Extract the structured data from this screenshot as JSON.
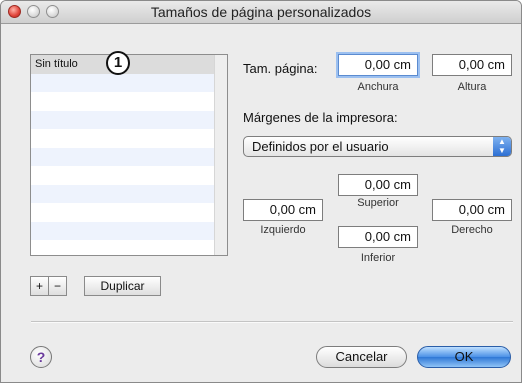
{
  "window": {
    "title": "Tamaños de página personalizados"
  },
  "list": {
    "items": [
      "Sin título",
      "",
      "",
      "",
      "",
      "",
      "",
      "",
      "",
      "",
      ""
    ],
    "selected_index": 0
  },
  "callout": "1",
  "list_buttons": {
    "add": "+",
    "remove": "−",
    "duplicate": "Duplicar"
  },
  "page_size": {
    "label": "Tam. página:",
    "width_value": "0,00 cm",
    "width_label": "Anchura",
    "height_value": "0,00 cm",
    "height_label": "Altura"
  },
  "margins": {
    "label": "Márgenes de la impresora:",
    "preset": "Definidos por el usuario",
    "top_value": "0,00 cm",
    "top_label": "Superior",
    "left_value": "0,00 cm",
    "left_label": "Izquierdo",
    "right_value": "0,00 cm",
    "right_label": "Derecho",
    "bottom_value": "0,00 cm",
    "bottom_label": "Inferior"
  },
  "footer": {
    "help": "?",
    "cancel": "Cancelar",
    "ok": "OK"
  },
  "colors": {
    "focus_ring": "#9cc0f0",
    "default_button": "#4a90e6",
    "list_stripe": "#eef3fd"
  }
}
